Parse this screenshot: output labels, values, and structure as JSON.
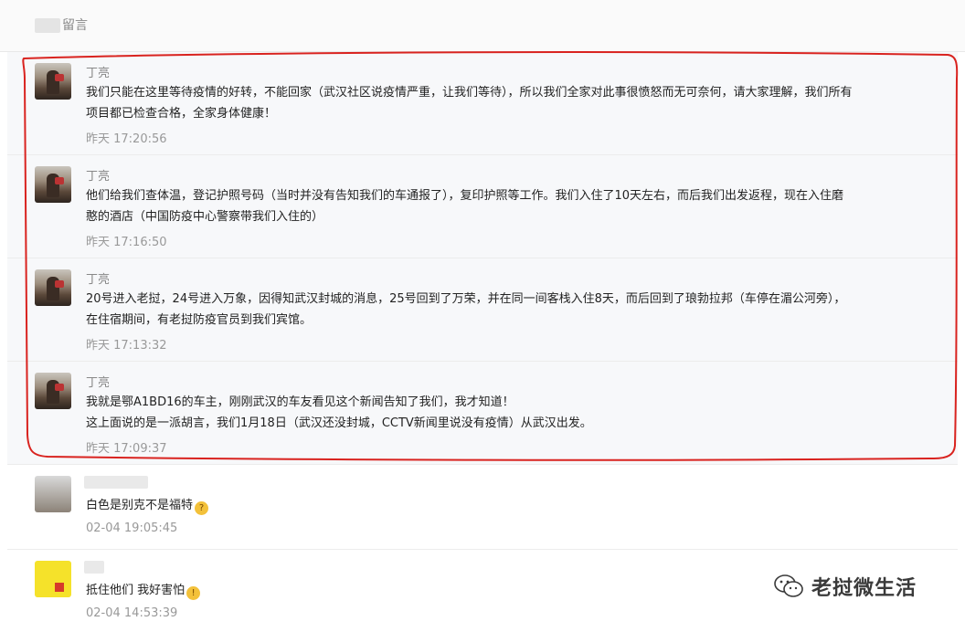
{
  "header": {
    "title": "留言"
  },
  "comments": [
    {
      "name": "丁亮",
      "lines": [
        "我们只能在这里等待疫情的好转，不能回家（武汉社区说疫情严重，让我们等待），所以我们全家对此事很愤怒而无可奈何，请大家理解，我们所有",
        "项目都已检查合格，全家身体健康！"
      ],
      "time": "昨天 17:20:56"
    },
    {
      "name": "丁亮",
      "lines": [
        "他们给我们查体温，登记护照号码（当时并没有告知我们的车通报了），复印护照等工作。我们入住了10天左右，而后我们出发返程，现在入住磨",
        "憨的酒店（中国防疫中心警察带我们入住的）"
      ],
      "time": "昨天 17:16:50"
    },
    {
      "name": "丁亮",
      "lines": [
        "20号进入老挝，24号进入万象，因得知武汉封城的消息，25号回到了万荣，并在同一间客栈入住8天，而后回到了琅勃拉邦（车停在湄公河旁），",
        "在住宿期间，有老挝防疫官员到我们宾馆。"
      ],
      "time": "昨天 17:13:32"
    },
    {
      "name": "丁亮",
      "lines": [
        "我就是鄂A1BD16的车主，刚刚武汉的车友看见这个新闻告知了我们，我才知道！",
        "这上面说的是一派胡言，我们1月18日（武汉还没封城，CCTV新闻里说没有疫情）从武汉出发。"
      ],
      "time": "昨天 17:09:37"
    },
    {
      "name": "",
      "lines": [
        "白色是别克不是福特"
      ],
      "emoji": "🤔",
      "time": "02-04 19:05:45"
    },
    {
      "name": "",
      "lines": [
        "抵住他们 我好害怕"
      ],
      "emoji": "😱",
      "time": "02-04 14:53:39"
    }
  ],
  "watermark": {
    "text": "老挝微生活",
    "icon": "wechat-icon"
  },
  "colors": {
    "annotation_red": "#d9231f",
    "time_gray": "#999999"
  }
}
